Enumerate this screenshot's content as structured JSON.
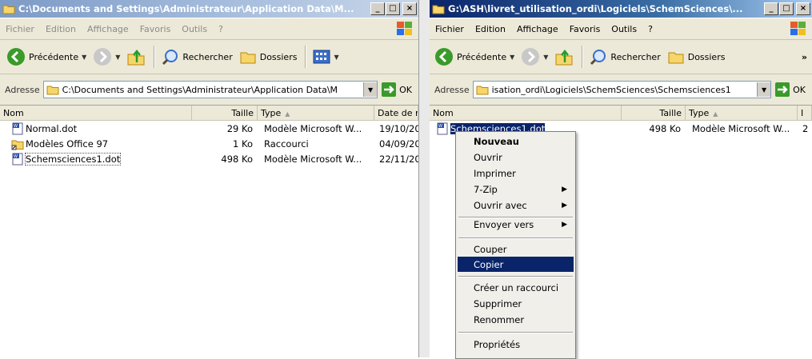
{
  "left_window": {
    "title": "C:\\Documents and Settings\\Administrateur\\Application Data\\M...",
    "menu": [
      "Fichier",
      "Edition",
      "Affichage",
      "Favoris",
      "Outils",
      "?"
    ],
    "toolbar": {
      "back_label": "Précédente",
      "search_label": "Rechercher",
      "folders_label": "Dossiers"
    },
    "address": {
      "label": "Adresse",
      "value": "C:\\Documents and Settings\\Administrateur\\Application Data\\M",
      "go_label": "OK"
    },
    "columns": {
      "name": "Nom",
      "size": "Taille",
      "type": "Type",
      "date": "Date de r"
    },
    "files": [
      {
        "name": "Normal.dot",
        "size": "29 Ko",
        "type": "Modèle Microsoft W...",
        "date": "19/10/20",
        "icon": "word-template-icon"
      },
      {
        "name": "Modèles Office 97",
        "size": "1 Ko",
        "type": "Raccourci",
        "date": "04/09/20",
        "icon": "shortcut-folder-icon"
      },
      {
        "name": "Schemsciences1.dot",
        "size": "498 Ko",
        "type": "Modèle Microsoft W...",
        "date": "22/11/20",
        "icon": "word-template-icon"
      }
    ]
  },
  "right_window": {
    "title": "G:\\ASH\\livret_utilisation_ordi\\Logiciels\\SchemSciences\\...",
    "menu": [
      "Fichier",
      "Edition",
      "Affichage",
      "Favoris",
      "Outils",
      "?"
    ],
    "toolbar": {
      "back_label": "Précédente",
      "search_label": "Rechercher",
      "folders_label": "Dossiers",
      "more": "»"
    },
    "address": {
      "label": "Adresse",
      "value": "isation_ordi\\Logiciels\\SchemSciences\\Schemsciences1",
      "go_label": "OK"
    },
    "columns": {
      "name": "Nom",
      "size": "Taille",
      "type": "Type",
      "date": "I"
    },
    "files": [
      {
        "name": "Schemsciences1.dot",
        "size": "498 Ko",
        "type": "Modèle Microsoft W...",
        "date": "2",
        "icon": "word-template-icon"
      }
    ]
  },
  "context_menu": {
    "items": [
      "Nouveau",
      "Ouvrir",
      "Imprimer",
      "7-Zip",
      "Ouvrir avec",
      "Envoyer vers",
      "Couper",
      "Copier",
      "Créer un raccourci",
      "Supprimer",
      "Renommer",
      "Propriétés"
    ],
    "highlighted": "Copier"
  },
  "colors": {
    "selection": "#0a246a",
    "active_title": "#0a246a",
    "inactive_title": "#7c9ac6",
    "menu_bg": "#ece9d8"
  }
}
